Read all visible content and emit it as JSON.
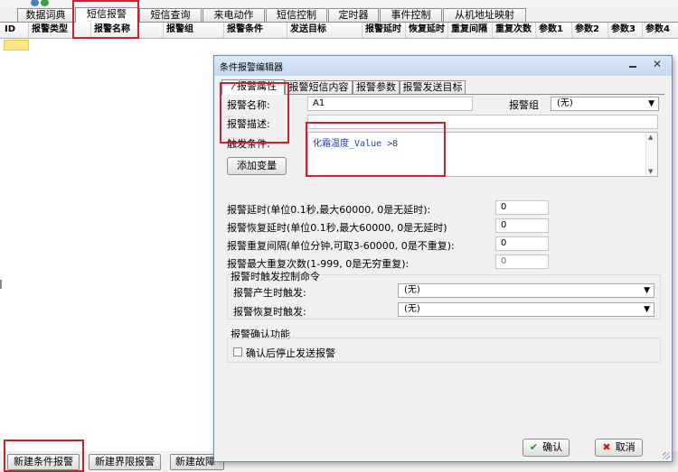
{
  "main": {
    "tabs": [
      {
        "label": "数据词典"
      },
      {
        "label": "短信报警"
      },
      {
        "label": "短信查询"
      },
      {
        "label": "来电动作"
      },
      {
        "label": "短信控制"
      },
      {
        "label": "定时器"
      },
      {
        "label": "事件控制"
      },
      {
        "label": "从机地址映射"
      }
    ],
    "active_tab": "短信报警",
    "columns": [
      "ID",
      "报警类型",
      "报警名称",
      "报警组",
      "报警条件",
      "发送目标",
      "报警延时",
      "恢复延时",
      "重复间隔",
      "重复次数",
      "参数1",
      "参数2",
      "参数3",
      "参数4"
    ],
    "bottom_buttons": {
      "new_condition": "新建条件报警",
      "new_limit": "新建界限报警",
      "new_fault": "新建故障"
    }
  },
  "dialog": {
    "title": "条件报警编辑器",
    "tabs": [
      {
        "label": "报警属性"
      },
      {
        "label": "报警短信内容"
      },
      {
        "label": "报警参数"
      },
      {
        "label": "报警发送目标"
      }
    ],
    "active_tab": "报警属性",
    "name_label": "报警名称:",
    "name_value": "A1",
    "group_label": "报警组",
    "group_value": "(无)",
    "desc_label": "报警描述:",
    "desc_value": "",
    "trigger_label": "触发条件:",
    "trigger_expr": "化霜温度_Value >8",
    "add_var_button": "添加变量",
    "delay_label": "报警延时(单位0.1秒,最大60000, 0是无延时):",
    "delay_value": "0",
    "recover_label": "报警恢复延时(单位0.1秒,最大60000, 0是无延时)",
    "recover_value": "0",
    "repeat_interval_label": "报警重复间隔(单位分钟,可取3-60000, 0是不重复):",
    "repeat_interval_value": "0",
    "max_repeat_label": "报警最大重复次数(1-999, 0是无穷重复):",
    "max_repeat_value": "0",
    "control_group_label": "报警时触发控制命令",
    "on_alarm_label": "报警产生时触发:",
    "on_alarm_value": "(无)",
    "on_recover_label": "报警恢复时触发:",
    "on_recover_value": "(无)",
    "confirm_group_label": "报警确认功能",
    "confirm_checkbox_label": "确认后停止发送报警",
    "confirm_checked": false,
    "ok_button": "确认",
    "cancel_button": "取消"
  },
  "colors": {
    "highlight_box": "#d0202e",
    "dialog_title_bg": "#c6d9ef",
    "selected_cell": "#ffe68a",
    "condition_text": "#1f3fbf"
  }
}
